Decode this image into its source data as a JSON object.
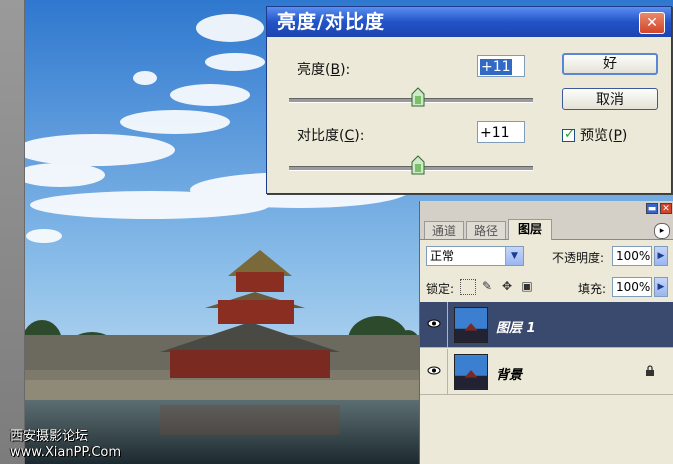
{
  "dialog": {
    "title": "亮度/对比度",
    "close_glyph": "✕",
    "brightness": {
      "label_pre": "亮度(",
      "mnemonic": "B",
      "label_post": "):",
      "value": "+11",
      "level": 0.53
    },
    "contrast": {
      "label_pre": "对比度(",
      "mnemonic": "C",
      "label_post": "):",
      "value": "+11",
      "level": 0.53
    },
    "ok_label": "好",
    "cancel_label": "取消",
    "preview": {
      "label_pre": "预览(",
      "mnemonic": "P",
      "label_post": ")",
      "checked": true,
      "check_glyph": "✓"
    }
  },
  "layers_panel": {
    "tabs": [
      "通道",
      "路径",
      "图层"
    ],
    "active_tab": 2,
    "menu_glyph": "▸",
    "blend_mode": "正常",
    "opacity_label": "不透明度:",
    "opacity_value": "100%",
    "lock_label": "锁定:",
    "fill_label": "填充:",
    "fill_value": "100%",
    "layers": [
      {
        "name": "图层 1",
        "selected": true,
        "locked": false
      },
      {
        "name": "背景",
        "selected": false,
        "locked": true
      }
    ],
    "minimize_glyph": "▬",
    "close_glyph": "✕"
  },
  "watermark": {
    "line1": "西安摄影论坛",
    "line2": "www.XianPP.Com"
  },
  "colors": {
    "title_blue": "#2353c8",
    "selected_layer": "#3a4a6e",
    "sky": "#4a8fd6"
  }
}
